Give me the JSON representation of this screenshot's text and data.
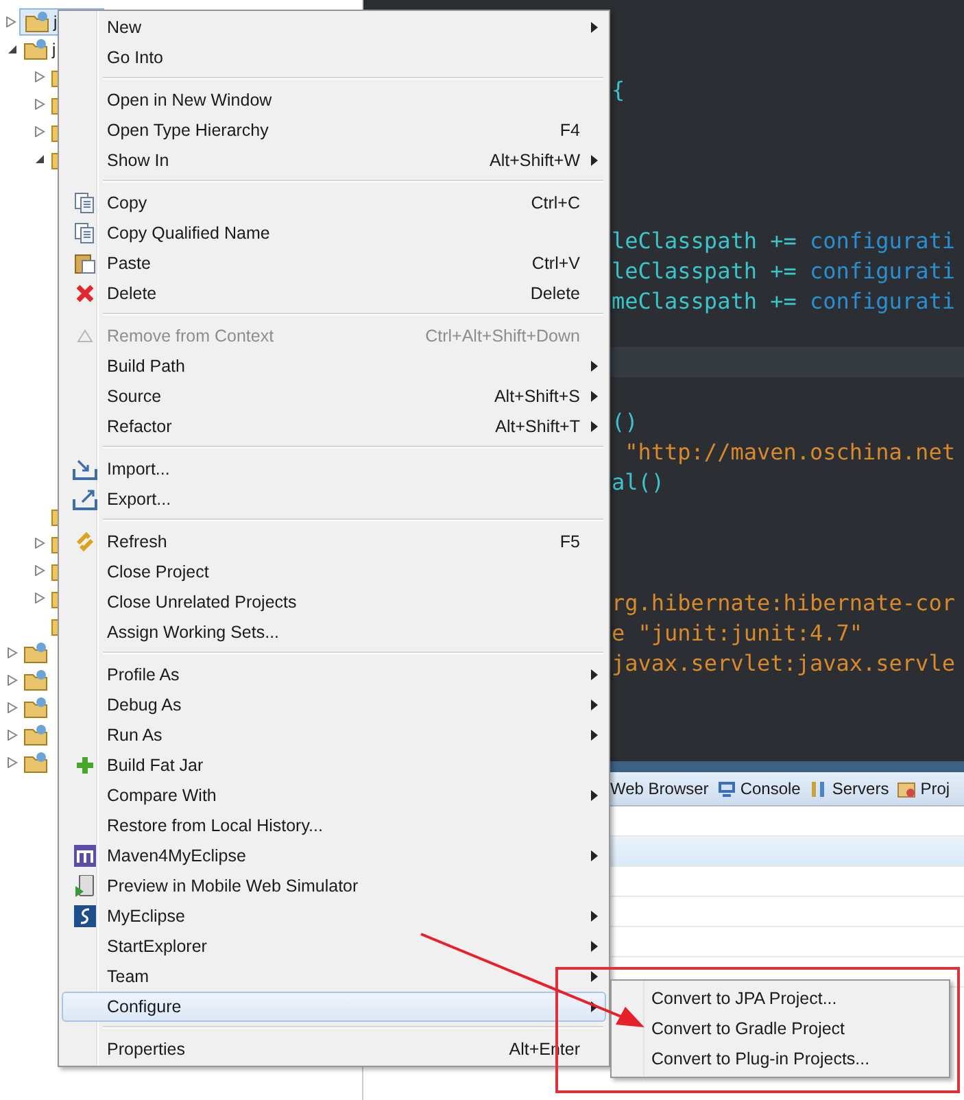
{
  "tree": [
    {
      "label": "j",
      "selected": true,
      "expanded": false
    },
    {
      "label": "j",
      "selected": false,
      "expanded": true,
      "children": [
        {
          "selected": false,
          "expanded": false
        },
        {
          "selected": false,
          "expanded": false
        },
        {
          "selected": false,
          "expanded": false
        },
        {
          "selected": false,
          "expanded": true
        },
        {
          "selected": false,
          "kind": "leaf"
        },
        {
          "selected": false,
          "expanded": false
        },
        {
          "selected": false,
          "expanded": false
        },
        {
          "selected": false,
          "expanded": false
        },
        {
          "selected": false,
          "kind": "leaf"
        }
      ]
    },
    {
      "selected": false,
      "expanded": false
    },
    {
      "selected": false,
      "expanded": false
    },
    {
      "selected": false,
      "expanded": false
    },
    {
      "selected": false,
      "expanded": false
    },
    {
      "selected": false,
      "expanded": false
    }
  ],
  "editor": {
    "lines": [
      {
        "kind": "top"
      },
      {
        "kind": "blank"
      },
      {
        "kind": "blank"
      },
      {
        "kind": "code",
        "segments": [
          {
            "kind": "plain",
            "text": "{"
          }
        ]
      },
      {
        "kind": "blank"
      },
      {
        "kind": "blank"
      },
      {
        "kind": "blank"
      },
      {
        "kind": "blank"
      },
      {
        "kind": "code",
        "segments": [
          {
            "kind": "plain",
            "text": "leClasspath += "
          },
          {
            "kind": "keyword",
            "text": "configurati"
          }
        ]
      },
      {
        "kind": "code",
        "segments": [
          {
            "kind": "plain",
            "text": "leClasspath += "
          },
          {
            "kind": "keyword",
            "text": "configurati"
          }
        ]
      },
      {
        "kind": "code",
        "segments": [
          {
            "kind": "plain",
            "text": "meClasspath += "
          },
          {
            "kind": "keyword",
            "text": "configurati"
          }
        ]
      },
      {
        "kind": "blank"
      },
      {
        "kind": "blank",
        "current": true
      },
      {
        "kind": "blank"
      },
      {
        "kind": "code",
        "segments": [
          {
            "kind": "plain",
            "text": "()"
          }
        ]
      },
      {
        "kind": "code",
        "segments": [
          {
            "kind": "string",
            "text": " \"http://maven.oschina.net"
          }
        ]
      },
      {
        "kind": "code",
        "segments": [
          {
            "kind": "plain",
            "text": "al()"
          }
        ]
      },
      {
        "kind": "blank"
      },
      {
        "kind": "blank"
      },
      {
        "kind": "blank"
      },
      {
        "kind": "code",
        "segments": [
          {
            "kind": "string",
            "text": "rg.hibernate:hibernate-cor"
          }
        ]
      },
      {
        "kind": "code",
        "segments": [
          {
            "kind": "string",
            "text": "e \"junit:junit:4.7\""
          }
        ]
      },
      {
        "kind": "code",
        "segments": [
          {
            "kind": "string",
            "text": "javax.servlet:javax.servle"
          }
        ]
      }
    ]
  },
  "bottom_panel": {
    "tabs": [
      {
        "label": "Web Browser"
      },
      {
        "label": "Console"
      },
      {
        "label": "Servers"
      },
      {
        "label": "Proj"
      }
    ]
  },
  "context_menu": {
    "groups": [
      [
        {
          "label": "New",
          "submenu": true,
          "selected": false
        },
        {
          "label": "Go Into",
          "selected": false
        }
      ],
      [
        {
          "label": "Open in New Window",
          "selected": false
        },
        {
          "label": "Open Type Hierarchy",
          "shortcut": "F4",
          "selected": false
        },
        {
          "label": "Show In",
          "shortcut": "Alt+Shift+W",
          "submenu": true,
          "selected": false
        }
      ],
      [
        {
          "label": "Copy",
          "shortcut": "Ctrl+C",
          "selected": false
        },
        {
          "label": "Copy Qualified Name",
          "selected": false
        },
        {
          "label": "Paste",
          "shortcut": "Ctrl+V",
          "selected": false
        },
        {
          "label": "Delete",
          "shortcut": "Delete",
          "selected": false
        }
      ],
      [
        {
          "label": "Remove from Context",
          "shortcut": "Ctrl+Alt+Shift+Down",
          "disabled": true,
          "selected": false
        },
        {
          "label": "Build Path",
          "submenu": true,
          "selected": false
        },
        {
          "label": "Source",
          "shortcut": "Alt+Shift+S",
          "submenu": true,
          "selected": false
        },
        {
          "label": "Refactor",
          "shortcut": "Alt+Shift+T",
          "submenu": true,
          "selected": false
        }
      ],
      [
        {
          "label": "Import...",
          "selected": false
        },
        {
          "label": "Export...",
          "selected": false
        }
      ],
      [
        {
          "label": "Refresh",
          "shortcut": "F5",
          "selected": false
        },
        {
          "label": "Close Project",
          "selected": false
        },
        {
          "label": "Close Unrelated Projects",
          "selected": false
        },
        {
          "label": "Assign Working Sets...",
          "selected": false
        }
      ],
      [
        {
          "label": "Profile As",
          "submenu": true,
          "selected": false
        },
        {
          "label": "Debug As",
          "submenu": true,
          "selected": false
        },
        {
          "label": "Run As",
          "submenu": true,
          "selected": false
        },
        {
          "label": "Build Fat Jar",
          "selected": false
        },
        {
          "label": "Compare With",
          "submenu": true,
          "selected": false
        },
        {
          "label": "Restore from Local History...",
          "selected": false
        },
        {
          "label": "Maven4MyEclipse",
          "submenu": true,
          "selected": false
        },
        {
          "label": "Preview in Mobile Web Simulator",
          "selected": false
        },
        {
          "label": "MyEclipse",
          "submenu": true,
          "selected": false
        },
        {
          "label": "StartExplorer",
          "submenu": true,
          "selected": false
        },
        {
          "label": "Team",
          "submenu": true,
          "selected": false
        },
        {
          "label": "Configure",
          "submenu": true,
          "selected": true
        }
      ],
      [
        {
          "label": "Properties",
          "shortcut": "Alt+Enter",
          "selected": false
        }
      ]
    ]
  },
  "submenu": {
    "items": [
      {
        "label": "Convert to JPA Project..."
      },
      {
        "label": "Convert to Gradle Project"
      },
      {
        "label": "Convert to Plug-in Projects..."
      }
    ]
  }
}
